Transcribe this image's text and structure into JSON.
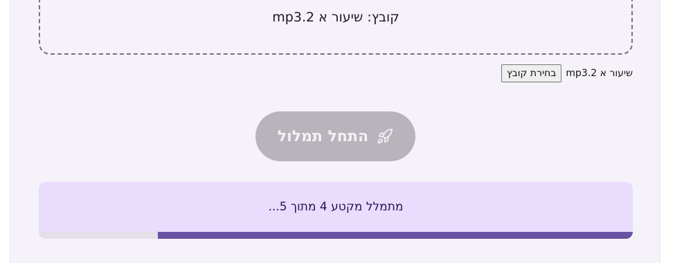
{
  "dropzone": {
    "label": "קובץ: שיעור א mp3.2"
  },
  "file_input": {
    "button_label": "בחירת קובץ",
    "file_name": "שיעור א mp3.2"
  },
  "start_button": {
    "label": "התחל תמלול",
    "icon": "rocket-icon",
    "enabled": false
  },
  "progress": {
    "status_text": "מתמלל מקטע 4 מתוך 5...",
    "fraction": 0.8
  },
  "colors": {
    "accent": "#6a52a3",
    "panel": "#e9dcfd",
    "button_disabled": "#b8b4bc"
  }
}
